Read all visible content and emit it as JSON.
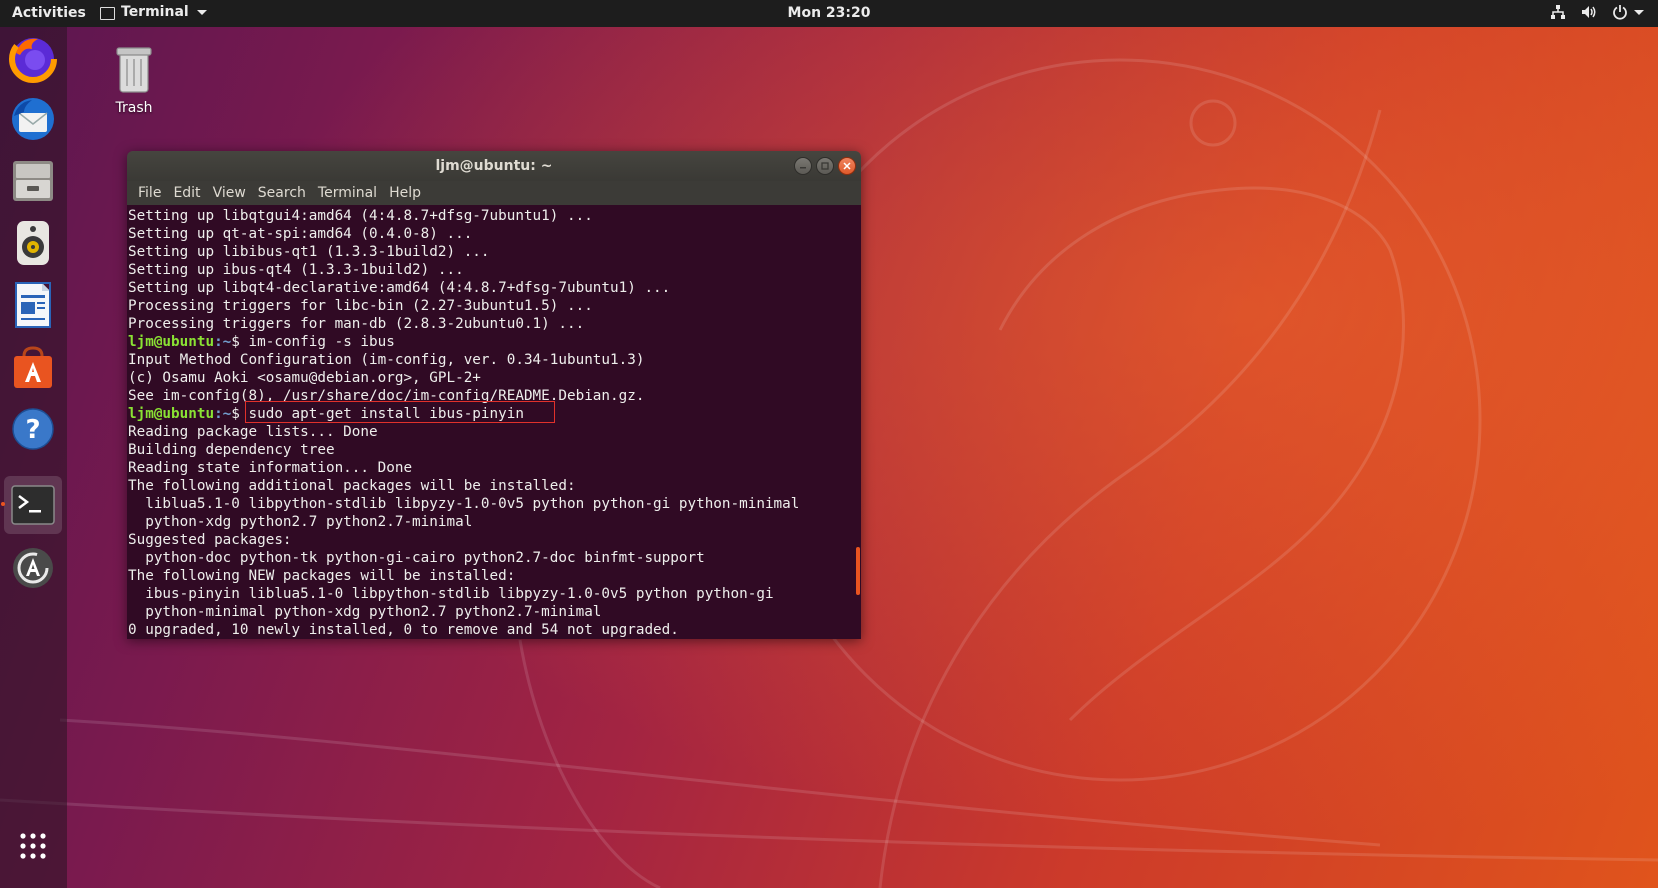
{
  "topbar": {
    "activities": "Activities",
    "app_menu": "Terminal",
    "clock": "Mon 23:20"
  },
  "desktop": {
    "trash_label": "Trash"
  },
  "dock": {
    "items": [
      {
        "icon": "firefox-icon"
      },
      {
        "icon": "thunderbird-icon"
      },
      {
        "icon": "files-icon"
      },
      {
        "icon": "rhythmbox-icon"
      },
      {
        "icon": "libreoffice-writer-icon"
      },
      {
        "icon": "ubuntu-software-icon"
      },
      {
        "icon": "help-icon"
      },
      {
        "icon": "terminal-icon",
        "active": true
      },
      {
        "icon": "software-updater-icon"
      },
      {
        "icon": "show-applications-icon"
      }
    ]
  },
  "terminal": {
    "title": "ljm@ubuntu: ~",
    "menu": [
      "File",
      "Edit",
      "View",
      "Search",
      "Terminal",
      "Help"
    ],
    "prompt_user": "ljm@ubuntu",
    "prompt_path": ":~",
    "prompt_symbol": "$ ",
    "lines": {
      "l0": "Setting up libqtgui4:amd64 (4:4.8.7+dfsg-7ubuntu1) ...",
      "l1": "Setting up qt-at-spi:amd64 (0.4.0-8) ...",
      "l2": "Setting up libibus-qt1 (1.3.3-1build2) ...",
      "l3": "Setting up ibus-qt4 (1.3.3-1build2) ...",
      "l4": "Setting up libqt4-declarative:amd64 (4:4.8.7+dfsg-7ubuntu1) ...",
      "l5": "Processing triggers for libc-bin (2.27-3ubuntu1.5) ...",
      "l6": "Processing triggers for man-db (2.8.3-2ubuntu0.1) ...",
      "l7_cmd": "im-config -s ibus",
      "l8": "Input Method Configuration (im-config, ver. 0.34-1ubuntu1.3)",
      "l9": "(c) Osamu Aoki <osamu@debian.org>, GPL-2+",
      "l10": "See im-config(8), /usr/share/doc/im-config/README.Debian.gz.",
      "l11_cmd": "sudo apt-get install ibus-pinyin",
      "l12": "Reading package lists... Done",
      "l13": "Building dependency tree",
      "l14": "Reading state information... Done",
      "l15": "The following additional packages will be installed:",
      "l16": "  liblua5.1-0 libpython-stdlib libpyzy-1.0-0v5 python python-gi python-minimal",
      "l17": "  python-xdg python2.7 python2.7-minimal",
      "l18": "Suggested packages:",
      "l19": "  python-doc python-tk python-gi-cairo python2.7-doc binfmt-support",
      "l20": "The following NEW packages will be installed:",
      "l21": "  ibus-pinyin liblua5.1-0 libpython-stdlib libpyzy-1.0-0v5 python python-gi",
      "l22": "  python-minimal python-xdg python2.7 python2.7-minimal",
      "l23": "0 upgraded, 10 newly installed, 0 to remove and 54 not upgraded."
    }
  },
  "colors": {
    "ubuntu_orange": "#e95420",
    "terminal_bg": "#300a24",
    "prompt_user": "#8ae234",
    "prompt_path": "#729fcf",
    "highlight": "#e0312b"
  }
}
